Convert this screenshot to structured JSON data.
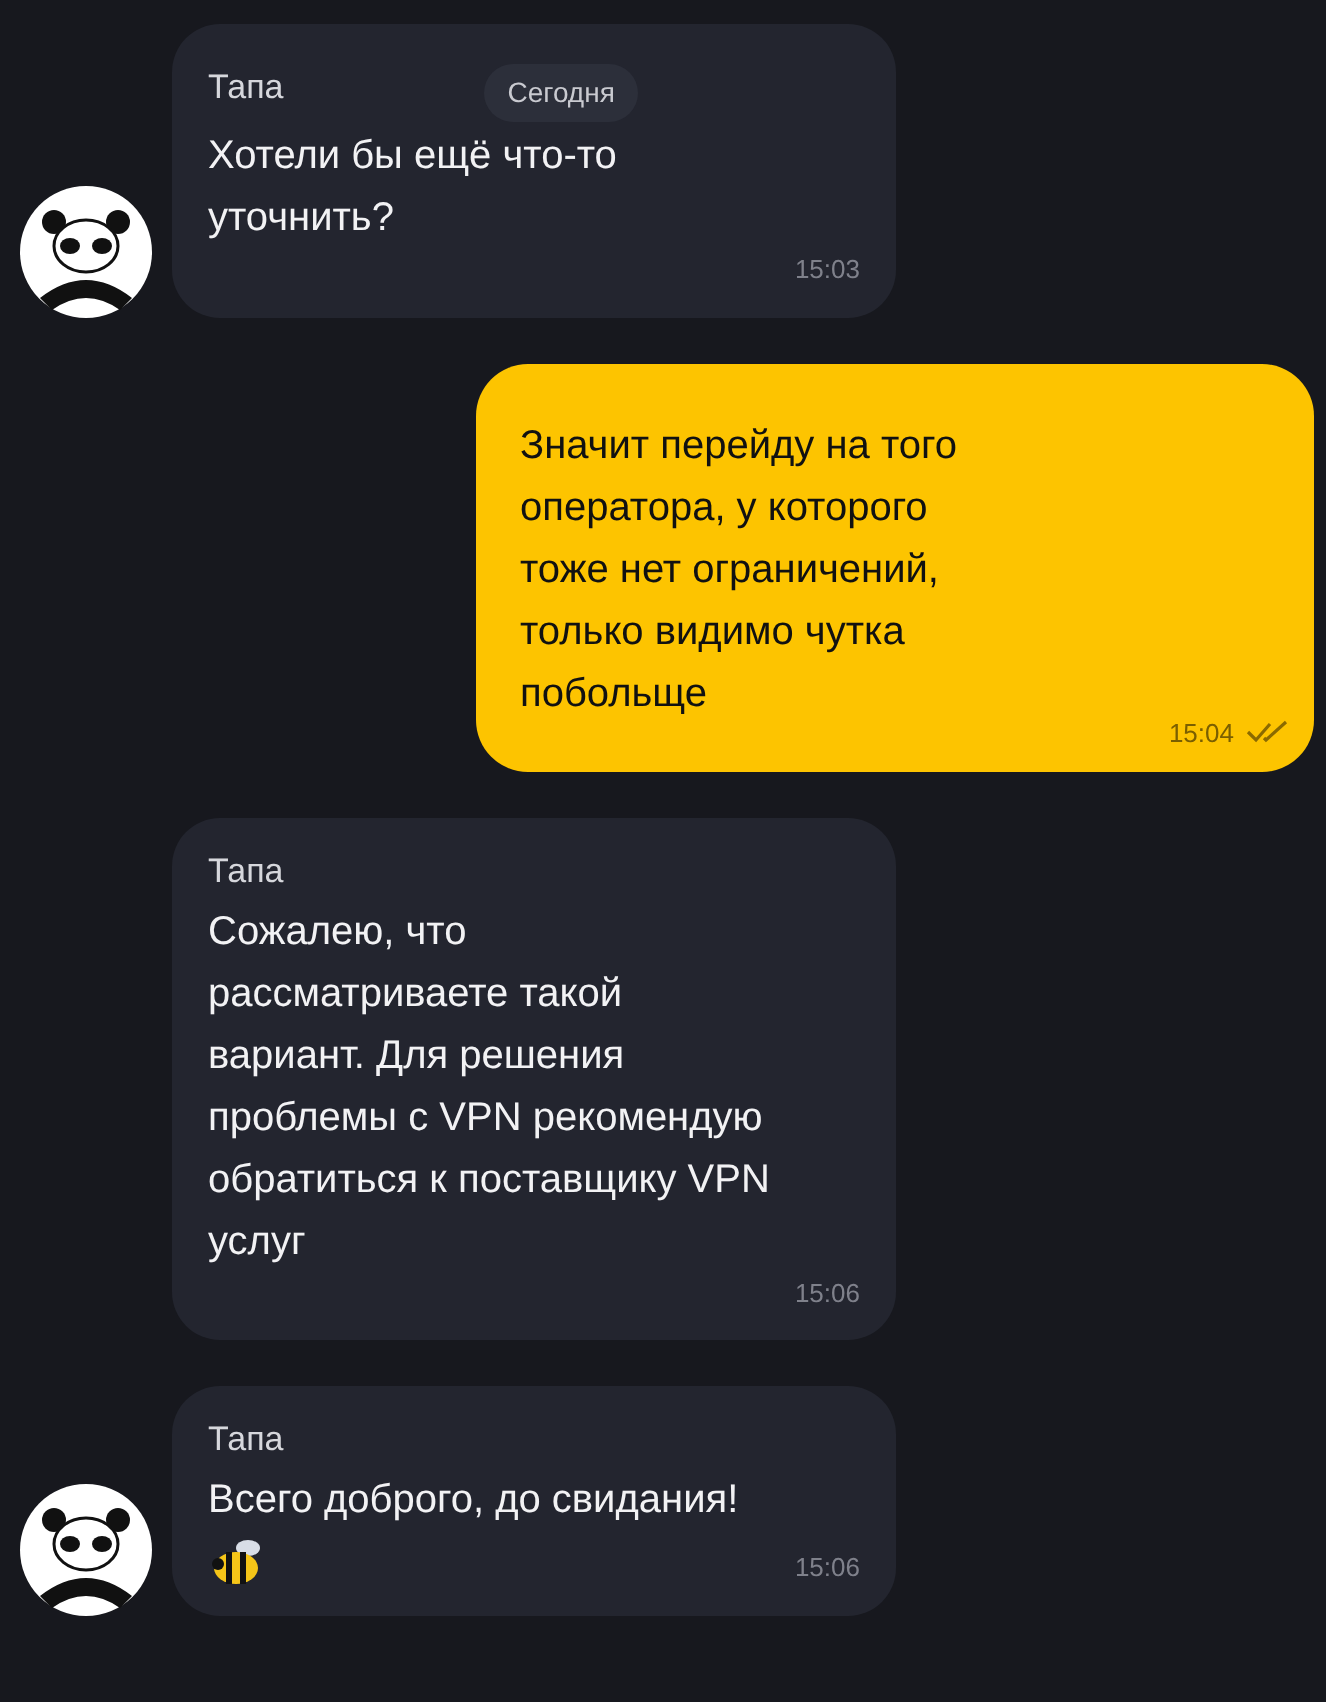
{
  "messages": [
    {
      "kind": "incoming",
      "sender": "Тапа",
      "date_badge": "Сегодня",
      "text": "Хотели бы ещё что-то\nуточнить?",
      "time": "15:03",
      "avatar": true
    },
    {
      "kind": "outgoing",
      "text": "Значит перейду на того\nоператора, у которого\nтоже нет ограничений,\nтолько видимо чутка\nпобольще",
      "time": "15:04",
      "read": true
    },
    {
      "kind": "incoming",
      "sender": "Тапа",
      "text": "Сожалею, что\nрассматриваете такой\nвариант. Для решения\nпроблемы с VPN рекомендую\nобратиться к поставщику VPN\nуслуг",
      "time": "15:06",
      "avatar": false
    },
    {
      "kind": "incoming",
      "sender": "Тапа",
      "text": "Всего доброго, до свидания!",
      "bee_sticker": true,
      "time": "15:06",
      "avatar": true
    }
  ]
}
